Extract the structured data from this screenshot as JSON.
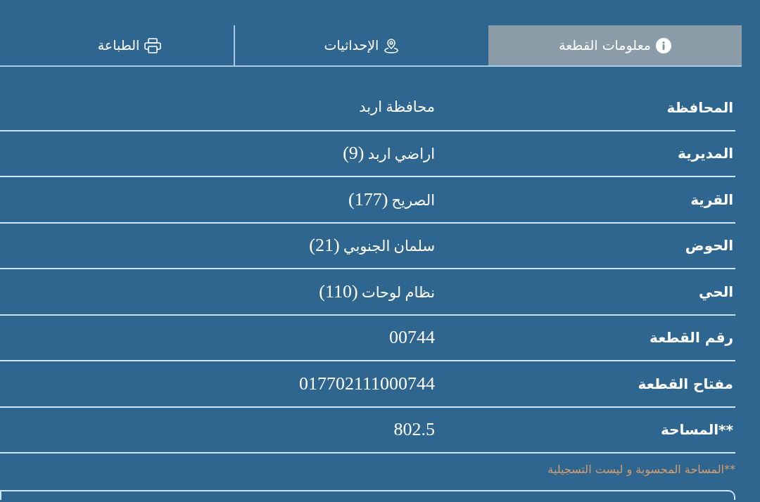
{
  "tabs": [
    {
      "label": "معلومات القطعة",
      "kind": "info",
      "selected": true
    },
    {
      "label": "الإحداثيات",
      "kind": "location",
      "selected": false
    },
    {
      "label": "الطباعة",
      "kind": "print",
      "selected": false
    }
  ],
  "fields": [
    {
      "label": "المحافظة",
      "value": "محافظة اربد"
    },
    {
      "label": "المديرية",
      "value": "اراضي اربد (9)"
    },
    {
      "label": "القرية",
      "value": "الصريح (177)"
    },
    {
      "label": "الحوض",
      "value": "سلمان الجنوبي (21)"
    },
    {
      "label": "الحي",
      "value": "نظام لوحات (110)"
    },
    {
      "label": "رقم القطعة",
      "value": "00744"
    },
    {
      "label": "مفتاح القطعة",
      "value": "017702111000744"
    },
    {
      "label": "**المساحة",
      "value": "802.5"
    }
  ],
  "footnote": "**المساحة المحسوبة و ليست التسجيلية"
}
